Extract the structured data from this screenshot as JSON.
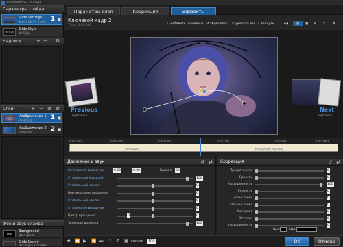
{
  "window": {
    "title": "Параметры слайда"
  },
  "left": {
    "slide_params_header": "Параметры слайда",
    "styles": [
      {
        "title": "Slide Settings",
        "sub": "Фон • эф • 9.0 сек",
        "num": "1"
      },
      {
        "title": "Slide Style",
        "sub": "No Style",
        "thumb": "no style"
      }
    ],
    "captions_header": "Надписи",
    "layers_header": "Слои",
    "layers": [
      {
        "title": "Изображение 1",
        "sub": "Image jpg",
        "num": "1"
      },
      {
        "title": "Изображение 2",
        "sub": "Image jpg",
        "num": "2"
      }
    ],
    "bg_sound_header": "Фон и звук слайда",
    "bg_rows": [
      {
        "title": "Background",
        "sub": "Цвет фона",
        "thumb": "color"
      },
      {
        "title": "Slide Sound",
        "sub": "Нет звука в слайде"
      }
    ]
  },
  "tabs": [
    "Параметры слоя",
    "Коррекция",
    "Эффекты"
  ],
  "active_tab": 2,
  "preview": {
    "title": "Ключевой кадр 2",
    "time": "Time: 0:00.000",
    "buttons": [
      "добавить несколько",
      "сброс всех",
      "удалить все",
      "вернуть"
    ],
    "prev_label": "Previous",
    "prev_sub": "Keyframe 1",
    "next_label": "Next",
    "next_sub": "Keyframe 3"
  },
  "timeline": {
    "ticks": [
      "0:00.000",
      "0:01.000",
      "0:02.000",
      "0:03.000",
      "0:04.000",
      "0:05.000"
    ],
    "left_label": "Анимация",
    "right_label": "Исходный переход"
  },
  "motion": {
    "header": "Движение и звук",
    "rows": [
      {
        "label": "Остановить движение",
        "v1": "0.00",
        "v2": "0.00",
        "extra": "Кривая",
        "v3": "30"
      },
      {
        "label": "Стабильный масштаб",
        "v1": "100"
      },
      {
        "label": "Стабильный наклон",
        "v1": "0"
      },
      {
        "label": "Вертикальное вращение",
        "v1": "0"
      },
      {
        "label": "Стабильный наклон",
        "v1": "0"
      },
      {
        "label": "Стабильное вращение",
        "v1": "0"
      },
      {
        "label": "Центр вращения",
        "v1": "0",
        "v2": "0"
      },
      {
        "label": "Звуковая дорожка",
        "v1": "100"
      }
    ]
  },
  "correction": {
    "header": "Коррекция",
    "rows": [
      {
        "label": "Прозрачность",
        "v": "0"
      },
      {
        "label": "Яркость",
        "v": "0"
      },
      {
        "label": "Насыщенность",
        "v": "100"
      },
      {
        "label": "Резкость",
        "v": "0"
      },
      {
        "label": "Белая точка",
        "v": "0"
      },
      {
        "label": "Черная точка",
        "v": "0"
      },
      {
        "label": "Контраст",
        "v": "0"
      },
      {
        "label": "Оттенок",
        "v": "0"
      },
      {
        "label": "Насыщенность",
        "v": "0"
      }
    ],
    "color_label": "Цвет",
    "color_label2": "Цвет"
  },
  "bottom": {
    "counter": "100",
    "label": "копия",
    "ok": "OK",
    "cancel": "Отмена"
  },
  "colors": {
    "accent": "#1f5f9c",
    "link": "#4a8fd6",
    "timeline": "#f0e9cf"
  }
}
